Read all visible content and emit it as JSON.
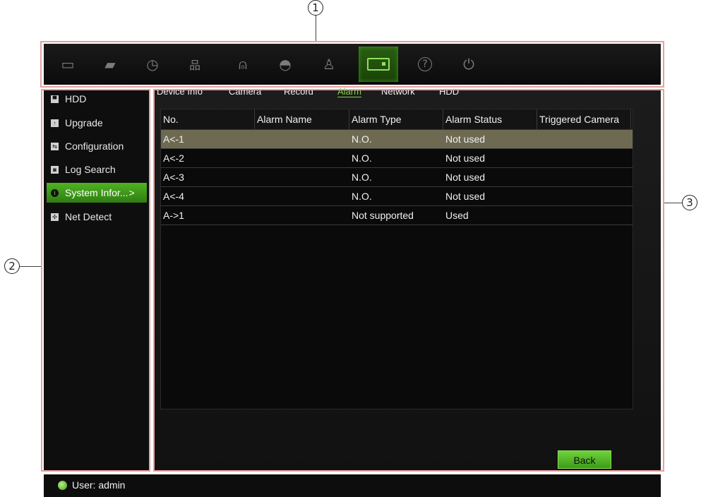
{
  "callouts": {
    "top": "1",
    "left": "2",
    "right": "3"
  },
  "toolbar": {
    "icons": [
      {
        "name": "monitor-icon",
        "glyph": "▭"
      },
      {
        "name": "camera-icon",
        "glyph": "▰"
      },
      {
        "name": "clock-icon",
        "glyph": "◷"
      },
      {
        "name": "network-icon",
        "glyph": "品"
      },
      {
        "name": "bell-icon",
        "glyph": "⍝"
      },
      {
        "name": "dome-camera-icon",
        "glyph": "◓"
      },
      {
        "name": "user-icon",
        "glyph": "♙"
      },
      {
        "name": "hdd-icon",
        "glyph": ""
      },
      {
        "name": "help-icon",
        "glyph": "?"
      },
      {
        "name": "power-icon",
        "glyph": "⏻"
      }
    ],
    "active_index": 7
  },
  "sidebar": {
    "items": [
      {
        "label": "HDD",
        "icon": "hdd-icon",
        "glyph": "▀"
      },
      {
        "label": "Upgrade",
        "icon": "upgrade-icon",
        "glyph": "↑"
      },
      {
        "label": "Configuration",
        "icon": "configuration-icon",
        "glyph": "⇆"
      },
      {
        "label": "Log Search",
        "icon": "log-search-icon",
        "glyph": "◙"
      },
      {
        "label": "System Infor...",
        "icon": "info-icon",
        "glyph": "i",
        "arrow": ">"
      },
      {
        "label": "Net Detect",
        "icon": "net-detect-icon",
        "glyph": "✣"
      }
    ],
    "active_index": 4
  },
  "tabs": [
    {
      "label": "Device Info"
    },
    {
      "label": "Camera"
    },
    {
      "label": "Record"
    },
    {
      "label": "Alarm"
    },
    {
      "label": "Network"
    },
    {
      "label": "HDD"
    }
  ],
  "active_tab": 3,
  "table": {
    "headers": [
      "No.",
      "Alarm Name",
      "Alarm Type",
      "Alarm Status",
      "Triggered Camera"
    ],
    "rows": [
      [
        "A<-1",
        "",
        "N.O.",
        "Not used",
        ""
      ],
      [
        "A<-2",
        "",
        "N.O.",
        "Not used",
        ""
      ],
      [
        "A<-3",
        "",
        "N.O.",
        "Not used",
        ""
      ],
      [
        "A<-4",
        "",
        "N.O.",
        "Not used",
        ""
      ],
      [
        "A->1",
        "",
        "Not supported",
        "Used",
        ""
      ]
    ],
    "selected_row": 0
  },
  "back_label": "Back",
  "status": {
    "text": "User: admin"
  },
  "colors": {
    "accent": "#4fb322",
    "selected_row": "#6e6a52",
    "highlight_box": "#e8a0a0"
  }
}
